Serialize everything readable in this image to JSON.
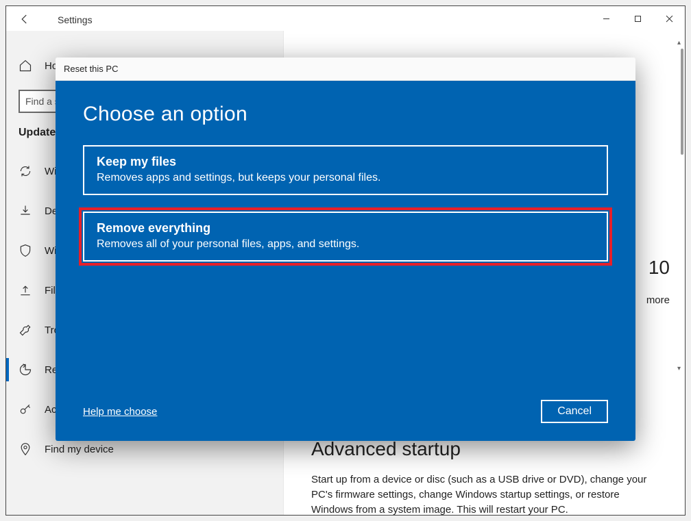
{
  "app": {
    "title": "Settings"
  },
  "search": {
    "placeholder": "Find a setting"
  },
  "sidebar": {
    "section": "Update & Security",
    "items": [
      {
        "label": "Home"
      },
      {
        "label": "Windows Update"
      },
      {
        "label": "Delivery Optimization"
      },
      {
        "label": "Windows Security"
      },
      {
        "label": "Files backup"
      },
      {
        "label": "Troubleshoot"
      },
      {
        "label": "Recovery"
      },
      {
        "label": "Activation"
      },
      {
        "label": "Find my device"
      }
    ]
  },
  "main": {
    "visible_right_fragment_1": "10",
    "visible_right_fragment_2": "more",
    "advanced": {
      "title": "Advanced startup",
      "body": "Start up from a device or disc (such as a USB drive or DVD), change your PC's firmware settings, change Windows startup settings, or restore Windows from a system image. This will restart your PC."
    }
  },
  "modal": {
    "title": "Reset this PC",
    "heading": "Choose an option",
    "options": [
      {
        "title": "Keep my files",
        "desc": "Removes apps and settings, but keeps your personal files."
      },
      {
        "title": "Remove everything",
        "desc": "Removes all of your personal files, apps, and settings."
      }
    ],
    "help_link": "Help me choose",
    "cancel": "Cancel"
  }
}
